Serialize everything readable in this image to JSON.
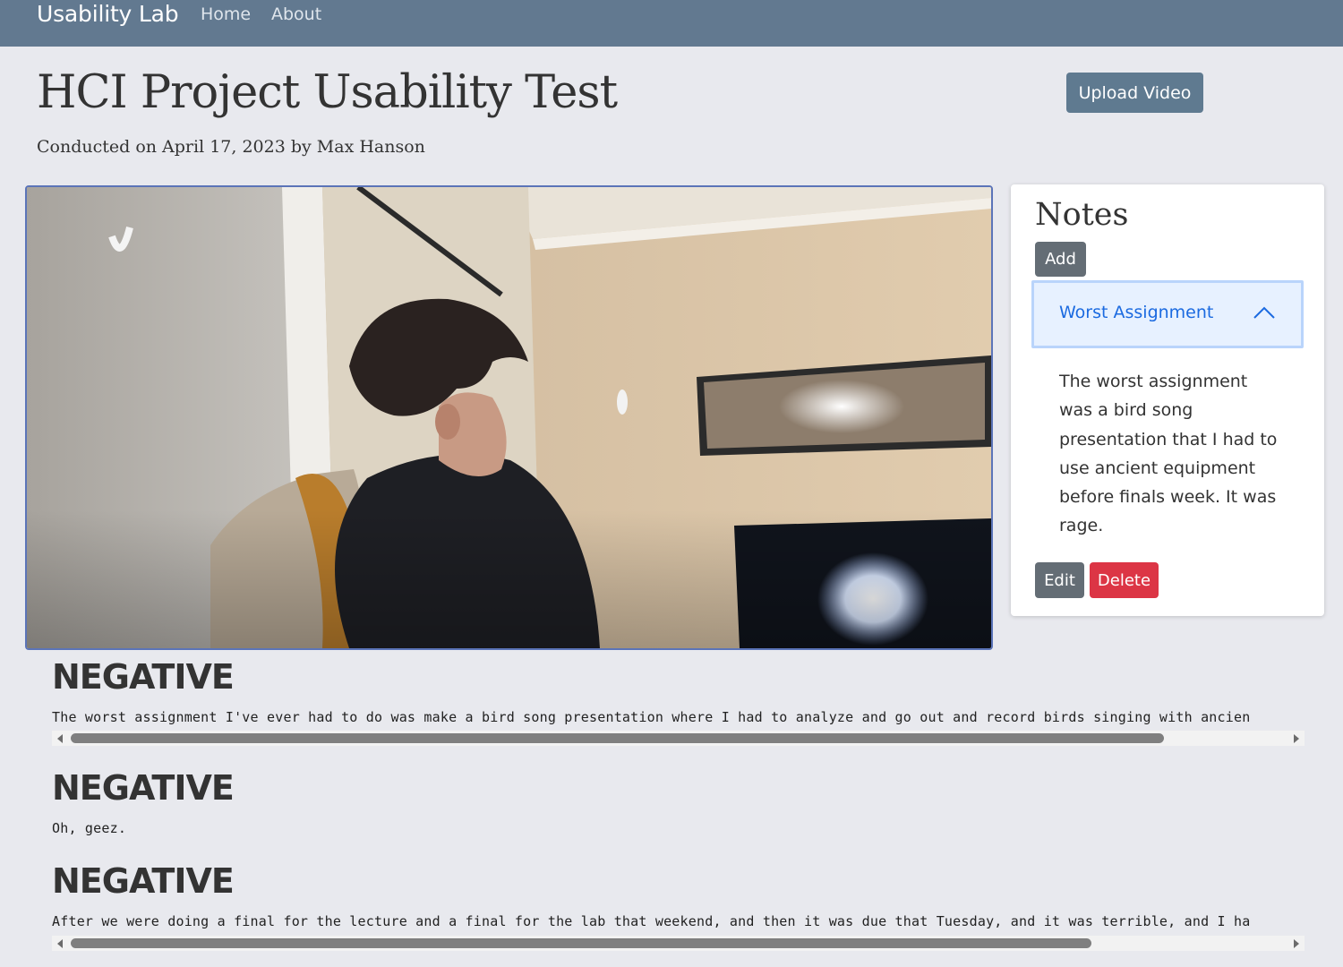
{
  "navbar": {
    "brand": "Usability Lab",
    "links": [
      "Home",
      "About"
    ]
  },
  "header": {
    "title": "HCI Project Usability Test",
    "subtitle": "Conducted on April 17, 2023 by Max Hanson",
    "upload_label": "Upload Video"
  },
  "video": {
    "description_icon": "video-frame"
  },
  "notes": {
    "title": "Notes",
    "add_label": "Add",
    "accordion_title": "Worst Assignment",
    "accordion_expanded": true,
    "body": "The worst assignment was a bird song presentation that I had to use ancient equipment before finals week. It was rage.",
    "edit_label": "Edit",
    "delete_label": "Delete"
  },
  "transcript": [
    {
      "sentiment": "NEGATIVE",
      "text": "The worst assignment I've ever had to do was make a bird song presentation where I had to analyze and go out and record birds singing with ancien",
      "scrollbar": true,
      "thumb_fraction": 0.9
    },
    {
      "sentiment": "NEGATIVE",
      "text": "Oh, geez.",
      "scrollbar": false
    },
    {
      "sentiment": "NEGATIVE",
      "text": "After we were doing a final for the lecture and a final for the lab that weekend, and then it was due that Tuesday, and it was terrible, and I ha",
      "scrollbar": true,
      "thumb_fraction": 0.84
    }
  ],
  "colors": {
    "navbar": "#627990",
    "primary_link": "#1b6ae0",
    "danger": "#dc3545",
    "secondary": "#646d75",
    "page_bg": "#e8e9ee"
  }
}
